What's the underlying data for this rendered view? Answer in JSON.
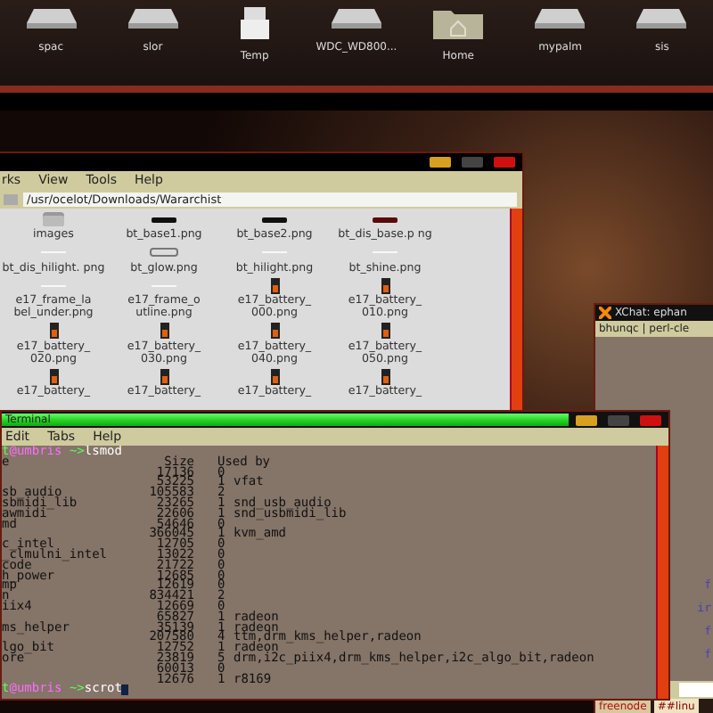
{
  "desktop_icons": [
    {
      "label": "spac",
      "kind": "drive"
    },
    {
      "label": "slor",
      "kind": "drive"
    },
    {
      "label": "Temp",
      "kind": "box"
    },
    {
      "label": "WDC_WD800...",
      "kind": "drive"
    },
    {
      "label": "Home",
      "kind": "folder"
    },
    {
      "label": "mypalm",
      "kind": "drive"
    },
    {
      "label": "sis",
      "kind": "drive"
    }
  ],
  "file_manager": {
    "menu": [
      "rks",
      "View",
      "Tools",
      "Help"
    ],
    "location": "/usr/ocelot/Downloads/Wararchist",
    "files": [
      {
        "name": "images",
        "kind": "folder"
      },
      {
        "name": "bt_base1.png",
        "kind": "bar",
        "color": "#101010"
      },
      {
        "name": "bt_base2.png",
        "kind": "bar",
        "color": "#101010"
      },
      {
        "name": "bt_dis_base.p ng",
        "kind": "bar",
        "color": "#5a0a0a"
      },
      {
        "name": "bt_dis_hilight. png",
        "kind": "line"
      },
      {
        "name": "bt_glow.png",
        "kind": "outline"
      },
      {
        "name": "bt_hilight.png",
        "kind": "line"
      },
      {
        "name": "bt_shine.png",
        "kind": "line"
      },
      {
        "name": "e17_frame_la bel_under.png",
        "kind": "line"
      },
      {
        "name": "e17_frame_o utline.png",
        "kind": "line"
      },
      {
        "name": "e17_battery_ 000.png",
        "kind": "battery"
      },
      {
        "name": "e17_battery_ 010.png",
        "kind": "battery"
      },
      {
        "name": "e17_battery_ 020.png",
        "kind": "battery"
      },
      {
        "name": "e17_battery_ 030.png",
        "kind": "battery"
      },
      {
        "name": "e17_battery_ 040.png",
        "kind": "battery"
      },
      {
        "name": "e17_battery_ 050.png",
        "kind": "battery"
      },
      {
        "name": "e17_battery_",
        "kind": "battery"
      },
      {
        "name": "e17_battery_",
        "kind": "battery"
      },
      {
        "name": "e17_battery_",
        "kind": "battery"
      },
      {
        "name": "e17_battery_",
        "kind": "battery"
      }
    ]
  },
  "xchat": {
    "title": "XChat: ephan",
    "topic": "bhunqc | perl-cle",
    "nick_fragments": [
      "f",
      "ir",
      "f",
      "f"
    ],
    "tabs": [
      {
        "label": "freenode",
        "selected": false
      },
      {
        "label": "##linu",
        "selected": true
      }
    ]
  },
  "terminal": {
    "title": "Terminal",
    "menu": [
      "Edit",
      "Tabs",
      "Help"
    ],
    "lines": [
      {
        "kind": "prompt",
        "user": "t",
        "at": "@",
        "host": "umbris",
        "path": "~>",
        "command": "lsmod",
        "cursor": false
      },
      {
        "kind": "header",
        "module": "e",
        "size": "Size",
        "used_by": "Used by"
      },
      {
        "kind": "row",
        "size": "17136",
        "count": "0"
      },
      {
        "kind": "row",
        "size": "53225",
        "count": "1",
        "used_by": "vfat"
      },
      {
        "kind": "row",
        "module": "sb_audio",
        "size": "105583",
        "count": "2"
      },
      {
        "kind": "row",
        "module": "sbmidi_lib",
        "size": "23265",
        "count": "1",
        "used_by": "snd_usb_audio"
      },
      {
        "kind": "row",
        "module": "awmidi",
        "size": "22606",
        "count": "1",
        "used_by": "snd_usbmidi_lib"
      },
      {
        "kind": "row",
        "module": "md",
        "size": "54646",
        "count": "0"
      },
      {
        "kind": "row",
        "size": "366045",
        "count": "1",
        "used_by": "kvm_amd"
      },
      {
        "kind": "row",
        "module": "c_intel",
        "size": "12705",
        "count": "0"
      },
      {
        "kind": "row",
        "module": "_clmulni_intel",
        "size": "13022",
        "count": "0"
      },
      {
        "kind": "row",
        "module": "code",
        "size": "21722",
        "count": "0"
      },
      {
        "kind": "row",
        "module": "h_power",
        "size": "12685",
        "count": "0"
      },
      {
        "kind": "row",
        "module": "mp",
        "size": "12619",
        "count": "0"
      },
      {
        "kind": "row",
        "module": "n",
        "size": "834421",
        "count": "2"
      },
      {
        "kind": "row",
        "module": "iix4",
        "size": "12669",
        "count": "0"
      },
      {
        "kind": "row",
        "size": "65827",
        "count": "1",
        "used_by": "radeon"
      },
      {
        "kind": "row",
        "module": "ms_helper",
        "size": "35139",
        "count": "1",
        "used_by": "radeon"
      },
      {
        "kind": "row",
        "size": "207580",
        "count": "4",
        "used_by": "ttm,drm_kms_helper,radeon"
      },
      {
        "kind": "row",
        "module": "lgo_bit",
        "size": "12752",
        "count": "1",
        "used_by": "radeon"
      },
      {
        "kind": "row",
        "module": "ore",
        "size": "23819",
        "count": "5",
        "used_by": "drm,i2c_piix4,drm_kms_helper,i2c_algo_bit,radeon"
      },
      {
        "kind": "row",
        "size": "60013",
        "count": "0"
      },
      {
        "kind": "row",
        "size": "12676",
        "count": "1",
        "used_by": "r8169"
      },
      {
        "kind": "prompt",
        "user": "t",
        "at": "@",
        "host": "umbris",
        "path": "~>",
        "command": "scrot",
        "cursor": true
      }
    ]
  }
}
